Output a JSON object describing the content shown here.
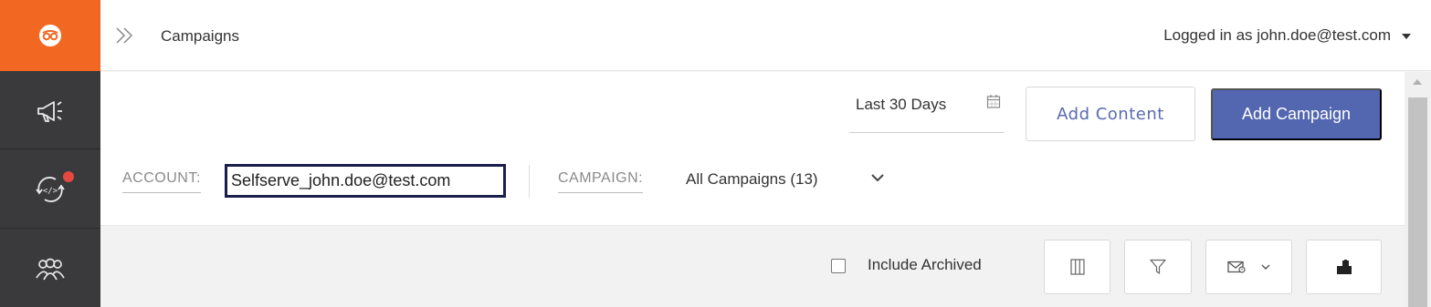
{
  "header": {
    "breadcrumb": "Campaigns",
    "user_label": "Logged in as john.doe@test.com"
  },
  "sidebar": {
    "items": [
      {
        "icon": "logo-icon"
      },
      {
        "icon": "megaphone-icon"
      },
      {
        "icon": "code-sync-icon",
        "notification": true
      },
      {
        "icon": "audience-icon"
      }
    ]
  },
  "toolbar": {
    "date_range": "Last 30 Days",
    "add_content_label": "Add Content",
    "add_campaign_label": "Add Campaign"
  },
  "filters": {
    "account_label": "ACCOUNT:",
    "account_value": "Selfserve_john.doe@test.com",
    "campaign_label": "CAMPAIGN:",
    "campaign_value": "All Campaigns (13)"
  },
  "table_tools": {
    "include_archived_label": "Include Archived",
    "include_archived_checked": false,
    "buttons": [
      "columns-icon",
      "filter-icon",
      "email-report-icon",
      "export-icon"
    ]
  },
  "colors": {
    "brand_orange": "#f26722",
    "primary_button": "#5366b0",
    "rail_bg": "#3a3a3c",
    "notification": "#e5483e",
    "highlight_border": "#1b1e4b"
  }
}
